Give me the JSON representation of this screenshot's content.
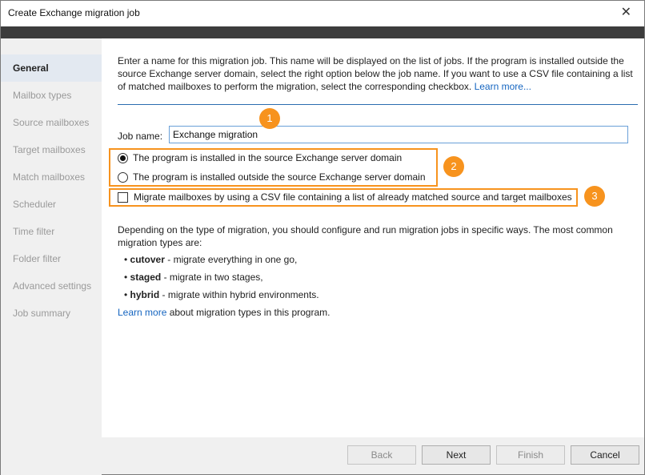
{
  "window": {
    "title": "Create Exchange migration job",
    "close_symbol": "✕"
  },
  "sidebar": {
    "items": [
      {
        "label": "General",
        "active": true
      },
      {
        "label": "Mailbox types"
      },
      {
        "label": "Source mailboxes"
      },
      {
        "label": "Target mailboxes"
      },
      {
        "label": "Match mailboxes"
      },
      {
        "label": "Scheduler"
      },
      {
        "label": "Time filter"
      },
      {
        "label": "Folder filter"
      },
      {
        "label": "Advanced settings"
      },
      {
        "label": "Job summary"
      }
    ]
  },
  "main": {
    "intro_text": "Enter a name for this migration job. This name will be displayed on the list of jobs. If the program is installed outside the source Exchange server domain, select the right option below the job name. If you want to use a CSV file containing a list of matched mailboxes to perform the migration, select the corresponding checkbox.",
    "intro_link": "Learn more...",
    "job_name_label": "Job name:",
    "job_name_value": "Exchange migration",
    "radio_inside": "The program is installed in the source Exchange server domain",
    "radio_outside": "The program is installed outside the source Exchange server domain",
    "csv_checkbox": "Migrate mailboxes by using a CSV file containing a list of already matched source and target mailboxes",
    "description": "Depending on the type of migration, you should configure and run migration jobs in specific ways. The most common migration types are:",
    "bullets": [
      {
        "term": "cutover",
        "text": " - migrate everything in one go,"
      },
      {
        "term": "staged",
        "text": " - migrate in two stages,"
      },
      {
        "term": "hybrid",
        "text": " - migrate within hybrid environments."
      }
    ],
    "learn_more_link": "Learn more",
    "learn_more_text": " about migration types in this program."
  },
  "annotations": {
    "badge1": "1",
    "badge2": "2",
    "badge3": "3",
    "color": "#f7931e"
  },
  "footer": {
    "back": "Back",
    "next": "Next",
    "finish": "Finish",
    "cancel": "Cancel"
  }
}
